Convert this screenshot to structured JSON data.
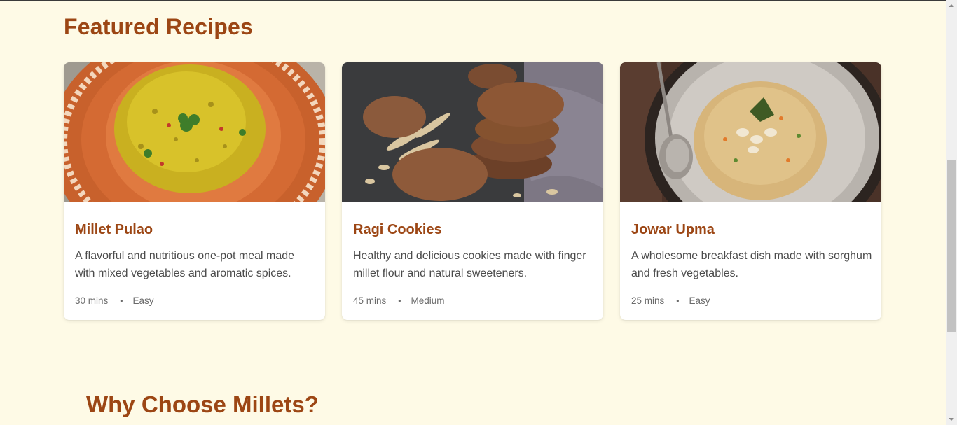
{
  "featured": {
    "title": "Featured Recipes",
    "recipes": [
      {
        "name": "Millet Pulao",
        "description": "A flavorful and nutritious one-pot meal made with mixed vegetables and aromatic spices.",
        "time": "30 mins",
        "difficulty": "Easy"
      },
      {
        "name": "Ragi Cookies",
        "description": "Healthy and delicious cookies made with finger millet flour and natural sweeteners.",
        "time": "45 mins",
        "difficulty": "Medium"
      },
      {
        "name": "Jowar Upma",
        "description": "A wholesome breakfast dish made with sorghum and fresh vegetables.",
        "time": "25 mins",
        "difficulty": "Easy"
      }
    ],
    "separator": "•"
  },
  "why": {
    "title": "Why Choose Millets?"
  },
  "colors": {
    "background": "#fefae6",
    "accent": "#9c4614",
    "card": "#ffffff"
  }
}
